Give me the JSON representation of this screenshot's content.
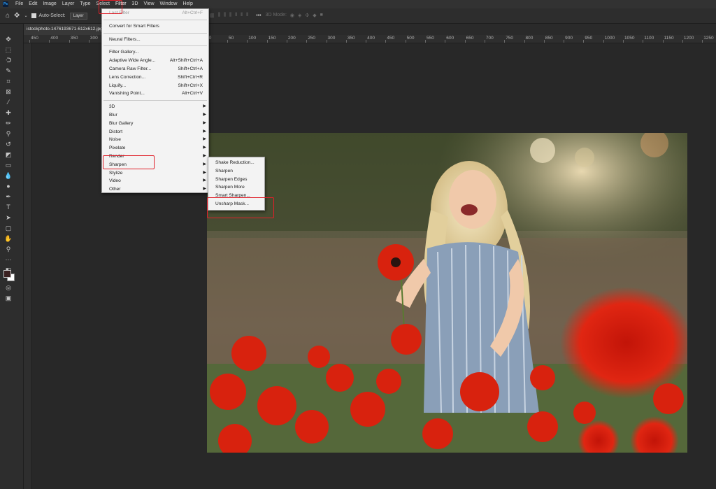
{
  "menubar": {
    "logo": "Ps",
    "items": [
      "File",
      "Edit",
      "Image",
      "Layer",
      "Type",
      "Select",
      "Filter",
      "3D",
      "View",
      "Window",
      "Help"
    ]
  },
  "options": {
    "auto_select_label": "Auto-Select:",
    "auto_select_value": "Layer",
    "mode_3d": "3D Mode:"
  },
  "document": {
    "tab_title": "istockphoto-1476193671-612x612.jpg"
  },
  "ruler_labels": [
    "450",
    "400",
    "350",
    "300",
    "250",
    "200",
    "150",
    "100",
    "50",
    "0",
    "50",
    "100",
    "150",
    "200",
    "250",
    "300",
    "350",
    "400",
    "450",
    "500",
    "550",
    "600",
    "650",
    "700",
    "750",
    "800",
    "850",
    "900",
    "950",
    "1000",
    "1050",
    "1100",
    "1150",
    "1200",
    "1250"
  ],
  "filter_menu": {
    "groups": [
      [
        {
          "label": "Last Filter",
          "shortcut": "Alt+Ctrl+F",
          "disabled": true
        }
      ],
      [
        {
          "label": "Convert for Smart Filters"
        }
      ],
      [
        {
          "label": "Neural Filters..."
        }
      ],
      [
        {
          "label": "Filter Gallery..."
        },
        {
          "label": "Adaptive Wide Angle...",
          "shortcut": "Alt+Shift+Ctrl+A"
        },
        {
          "label": "Camera Raw Filter...",
          "shortcut": "Shift+Ctrl+A"
        },
        {
          "label": "Lens Correction...",
          "shortcut": "Shift+Ctrl+R"
        },
        {
          "label": "Liquify...",
          "shortcut": "Shift+Ctrl+X"
        },
        {
          "label": "Vanishing Point...",
          "shortcut": "Alt+Ctrl+V"
        }
      ],
      [
        {
          "label": "3D",
          "submenu": true
        },
        {
          "label": "Blur",
          "submenu": true
        },
        {
          "label": "Blur Gallery",
          "submenu": true
        },
        {
          "label": "Distort",
          "submenu": true
        },
        {
          "label": "Noise",
          "submenu": true
        },
        {
          "label": "Pixelate",
          "submenu": true
        },
        {
          "label": "Render",
          "submenu": true
        },
        {
          "label": "Sharpen",
          "submenu": true
        },
        {
          "label": "Stylize",
          "submenu": true
        },
        {
          "label": "Video",
          "submenu": true
        },
        {
          "label": "Other",
          "submenu": true
        }
      ]
    ]
  },
  "sharpen_submenu": {
    "items": [
      "Shake Reduction...",
      "Sharpen",
      "Sharpen Edges",
      "Sharpen More",
      "Smart Sharpen...",
      "Unsharp Mask..."
    ]
  },
  "colors": {
    "highlight": "#e0202a",
    "ps_blue": "#31a8ff"
  }
}
